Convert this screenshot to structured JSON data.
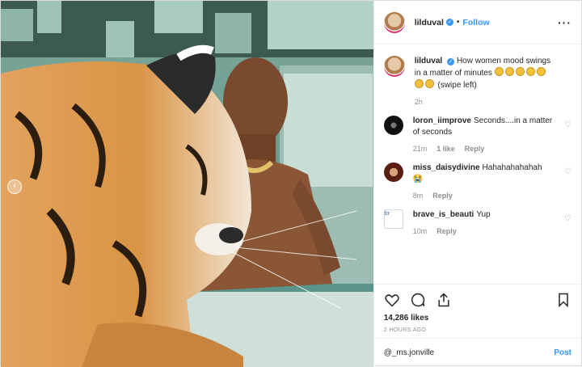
{
  "post": {
    "username": "lilduval",
    "follow_label": "Follow",
    "dot": "•",
    "more_icon": "more-options-icon",
    "caption": {
      "username": "lilduval",
      "text": "How women mood swings in a matter of minutes",
      "emoji": "😂",
      "emoji_count": 7,
      "trailing": "(swipe left)",
      "time": "2h"
    },
    "comments": [
      {
        "username": "loron_iimprove",
        "text": "Seconds....in a matter of seconds",
        "time": "21m",
        "likes": "1 like",
        "reply": "Reply",
        "avatar": "dark"
      },
      {
        "username": "miss_daisydivine",
        "text": "Hahahahahahah",
        "time": "8m",
        "likes": "",
        "reply": "Reply",
        "avatar": "red"
      },
      {
        "username": "brave_is_beauti",
        "text": "Yup",
        "time": "10m",
        "likes": "",
        "reply": "Reply",
        "avatar": "broken",
        "avatar_alt": "br"
      }
    ],
    "likes": "14,286 likes",
    "time_ago": "2 HOURS AGO",
    "comment_placeholder": "@_ms.jonville",
    "post_label": "Post",
    "colors": {
      "accent": "#3897f0",
      "muted": "#8e8e8e",
      "text": "#262626"
    }
  }
}
